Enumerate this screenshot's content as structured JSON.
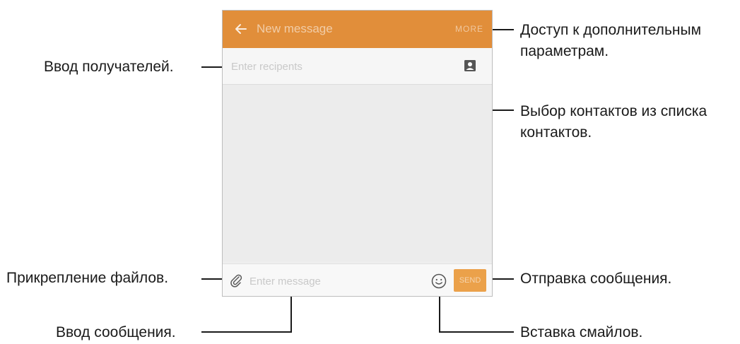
{
  "screen": {
    "title": "New message",
    "more_label": "MORE",
    "recipient_placeholder": "Enter recipents",
    "message_placeholder": "Enter message",
    "send_label": "SEND",
    "accent_color": "#e18e3a"
  },
  "icons": {
    "back": "arrow-left-icon",
    "contacts": "contact-card-icon",
    "attach": "paperclip-icon",
    "emoji": "smiley-icon"
  },
  "callouts": {
    "more_options_line1": "Доступ к дополнительным",
    "more_options_line2": "параметрам.",
    "enter_recipients": "Ввод получателей.",
    "select_contacts_line1": "Выбор контактов из списка",
    "select_contacts_line2": "контактов.",
    "attach_files": "Прикрепление файлов.",
    "send_message": "Отправка сообщения.",
    "enter_message": "Ввод сообщения.",
    "insert_emoticons": "Вставка смайлов."
  }
}
